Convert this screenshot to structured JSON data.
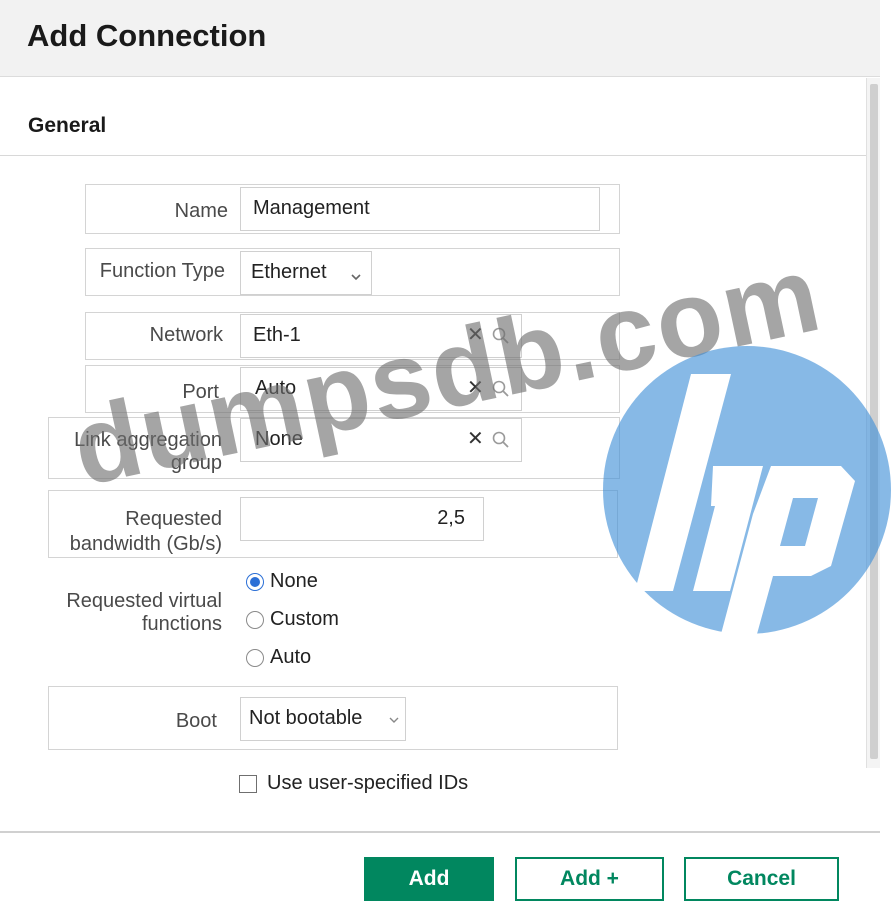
{
  "dialog": {
    "title": "Add Connection"
  },
  "section": {
    "title": "General"
  },
  "fields": {
    "name": {
      "label": "Name",
      "value": "Management"
    },
    "function_type": {
      "label": "Function Type",
      "value": "Ethernet"
    },
    "network": {
      "label": "Network",
      "value": "Eth-1"
    },
    "port": {
      "label": "Port",
      "value": "Auto"
    },
    "lag": {
      "label_line1": "Link aggregation",
      "label_line2": "group",
      "value": "None"
    },
    "bandwidth": {
      "label_line1": "Requested",
      "label_line2": "bandwidth (Gb/s)",
      "value": "2,5"
    },
    "virtual_functions": {
      "label_line1": "Requested virtual",
      "label_line2": "functions",
      "options": [
        {
          "label": "None",
          "checked": true
        },
        {
          "label": "Custom",
          "checked": false
        },
        {
          "label": "Auto",
          "checked": false
        }
      ]
    },
    "boot": {
      "label": "Boot",
      "value": "Not bootable"
    },
    "user_ids": {
      "label": "Use user-specified IDs",
      "checked": false
    }
  },
  "buttons": {
    "add": "Add",
    "add_plus": "Add +",
    "cancel": "Cancel"
  },
  "icons": {
    "clear": "clear-icon",
    "search": "search-icon",
    "dropdown": "chevron-down-icon"
  },
  "colors": {
    "accent": "#01875f",
    "radio_selected": "#2b6fd6",
    "watermark_logo": "#3f8fd8"
  },
  "watermark": {
    "text": "dumpsdb.com"
  }
}
